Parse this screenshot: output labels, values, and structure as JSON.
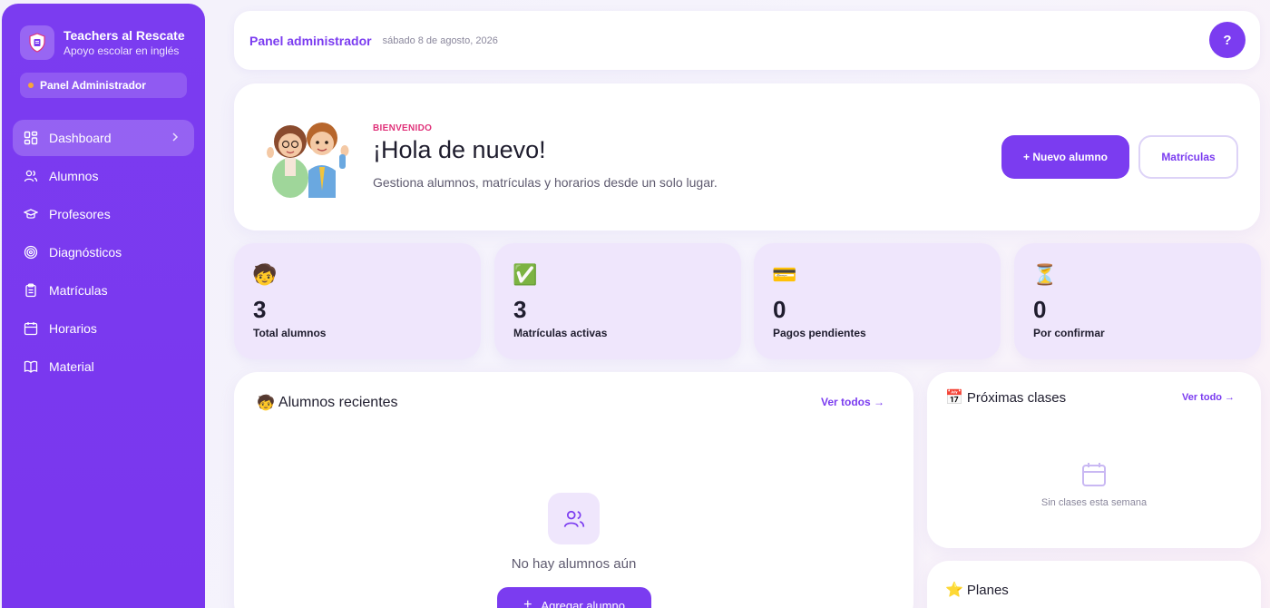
{
  "brand": {
    "title": "Teachers al Rescate",
    "subtitle": "Apoyo escolar en inglés"
  },
  "role_badge": "Panel Administrador",
  "sidebar": {
    "items": [
      {
        "label": "Dashboard",
        "icon": "dashboard-icon",
        "active": true
      },
      {
        "label": "Alumnos",
        "icon": "users-icon"
      },
      {
        "label": "Profesores",
        "icon": "graduation-cap-icon"
      },
      {
        "label": "Diagnósticos",
        "icon": "target-icon"
      },
      {
        "label": "Matrículas",
        "icon": "clipboard-icon"
      },
      {
        "label": "Horarios",
        "icon": "calendar-icon"
      },
      {
        "label": "Material",
        "icon": "book-icon"
      }
    ]
  },
  "header": {
    "title": "Panel administrador",
    "date": "sábado 8 de agosto, 2026",
    "help_label": "?"
  },
  "welcome": {
    "kicker": "BIENVENIDO",
    "title": "¡Hola de nuevo!",
    "subtitle": "Gestiona alumnos, matrículas y horarios desde un solo lugar.",
    "primary_button": "+ Nuevo alumno",
    "secondary_button": "Matrículas"
  },
  "stats": [
    {
      "emoji": "🧒",
      "value": "3",
      "label": "Total alumnos"
    },
    {
      "emoji": "✅",
      "value": "3",
      "label": "Matrículas activas"
    },
    {
      "emoji": "💳",
      "value": "0",
      "label": "Pagos pendientes"
    },
    {
      "emoji": "⏳",
      "value": "0",
      "label": "Por confirmar"
    }
  ],
  "recent_students": {
    "emoji": "🧒",
    "title": "Alumnos recientes",
    "link": "Ver todos →",
    "empty_text": "No hay alumnos aún",
    "add_button": "Agregar alumno",
    "add_button_icon": "+"
  },
  "next_classes": {
    "emoji": "📅",
    "title": "Próximas clases",
    "link": "Ver todo →",
    "empty_text": "Sin clases esta semana"
  },
  "plans": {
    "emoji": "⭐",
    "title": "Planes"
  },
  "colors": {
    "accent": "#7b3cf0",
    "kicker": "#e0327a",
    "stat_bg": "#efe6fc"
  }
}
